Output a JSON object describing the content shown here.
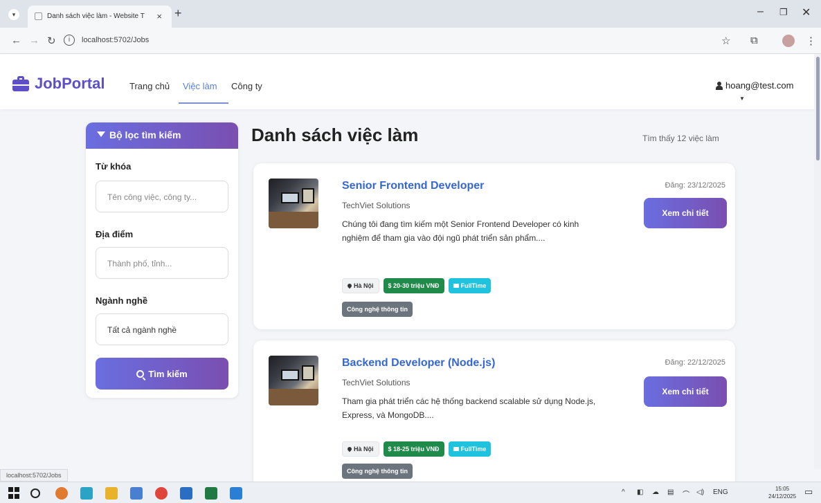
{
  "browser": {
    "tab_title": "Danh sách việc làm - Website T",
    "tab_close": "×",
    "new_tab": "+",
    "url": "localhost:5702/Jobs",
    "status_url": "localhost:5702/Jobs"
  },
  "navbar": {
    "brand": "JobPortal",
    "links": [
      "Trang chủ",
      "Việc làm",
      "Công ty"
    ],
    "active_link": "Việc làm",
    "user_email": "hoang@test.com"
  },
  "filter": {
    "title": "Bộ lọc tìm kiếm",
    "keyword_label": "Từ khóa",
    "keyword_placeholder": "Tên công việc, công ty...",
    "location_label": "Địa điểm",
    "location_placeholder": "Thành phố, tỉnh...",
    "industry_label": "Ngành nghề",
    "industry_value": "Tất cả ngành nghề",
    "search_button": "Tìm kiếm"
  },
  "main": {
    "title": "Danh sách việc làm",
    "count_text": "Tìm thấy 12 việc làm",
    "jobs": [
      {
        "title": "Senior Frontend Developer",
        "company": "TechViet Solutions",
        "description": "Chúng tôi đang tìm kiếm một Senior Frontend Developer có kinh nghiệm để tham gia vào đội ngũ phát triển sản phẩm....",
        "date": "Đăng: 23/12/2025",
        "detail_button": "Xem chi tiết",
        "location": "Hà Nội",
        "salary": "$ 20-30 triệu VNĐ",
        "type": "FullTime",
        "industry": "Công nghệ thông tin"
      },
      {
        "title": "Backend Developer (Node.js)",
        "company": "TechViet Solutions",
        "description": "Tham gia phát triển các hệ thống backend scalable sử dụng Node.js, Express, và MongoDB....",
        "date": "Đăng: 22/12/2025",
        "detail_button": "Xem chi tiết",
        "location": "Hà Nội",
        "salary": "$ 18-25 triệu VNĐ",
        "type": "FullTime",
        "industry": "Công nghệ thông tin"
      }
    ]
  },
  "taskbar": {
    "language": "ENG",
    "time": "15:05",
    "date": "24/12/2025"
  },
  "colors": {
    "brand": "#5d4fc7",
    "gradient_start": "#6a6ee0",
    "gradient_end": "#7a4fb0",
    "link_blue": "#3567d4"
  }
}
